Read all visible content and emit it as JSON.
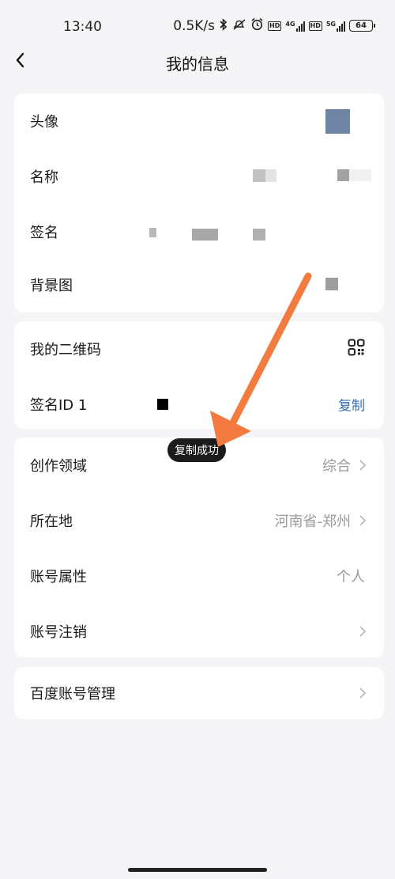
{
  "status_bar": {
    "time": "13:40",
    "network_speed": "0.5K/s",
    "battery": "64",
    "icons": [
      "bluetooth-icon",
      "mute-icon",
      "alarm-icon",
      "hd-icon",
      "signal-4g-icon",
      "hd-icon",
      "signal-5g-icon",
      "battery-icon"
    ],
    "badge_hd": "HD",
    "badge_4g": "4G",
    "badge_5g": "5G"
  },
  "nav": {
    "back_icon": "chevron-left-icon",
    "title": "我的信息"
  },
  "profile_card": {
    "avatar_label": "头像",
    "name_label": "名称",
    "signature_label": "签名",
    "background_label": "背景图"
  },
  "id_card": {
    "qrcode_label": "我的二维码",
    "qrcode_icon": "qr-code-icon",
    "id_label": "签名ID 1",
    "copy_label": "复制"
  },
  "settings_card": {
    "domain_label": "创作领域",
    "domain_value": "综合",
    "location_label": "所在地",
    "location_value": "河南省-郑州",
    "account_type_label": "账号属性",
    "account_type_value": "个人",
    "account_cancel_label": "账号注销"
  },
  "baidu_card": {
    "manage_label": "百度账号管理"
  },
  "toast": {
    "text": "复制成功"
  },
  "colors": {
    "background": "#f5f5f7",
    "card": "#ffffff",
    "link": "#3a6fb0",
    "secondary_text": "#9a9a9a",
    "annotation_arrow": "#f47b3f",
    "toast_bg": "#1c1c1c"
  }
}
